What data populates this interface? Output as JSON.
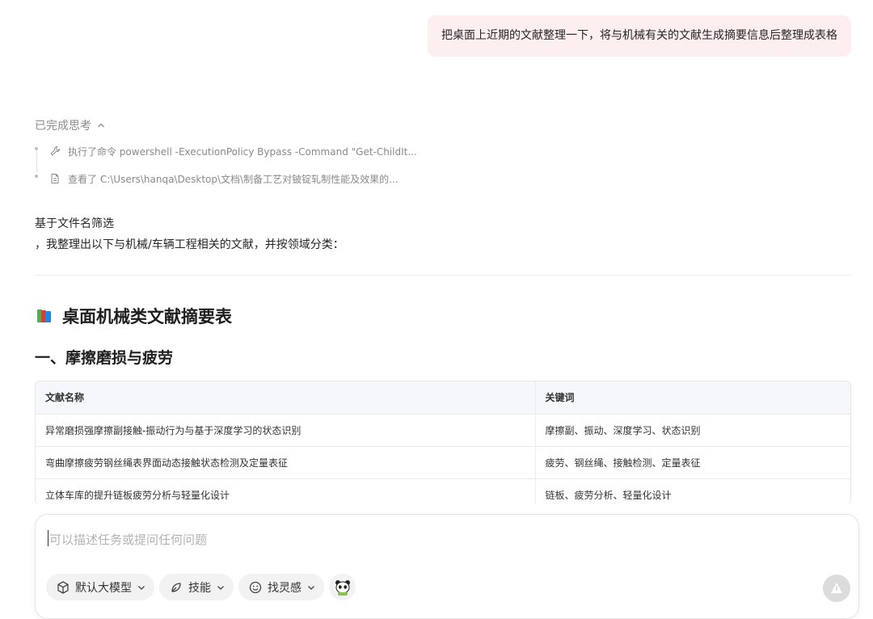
{
  "user_message": "把桌面上近期的文献整理一下，将与机械有关的文献生成摘要信息后整理成表格",
  "thinking": {
    "label": "已完成思考",
    "steps": [
      {
        "icon": "wrench-icon",
        "text": "执行了命令 powershell -ExecutionPolicy Bypass -Command \"Get-ChildIt..."
      },
      {
        "icon": "document-icon",
        "text": "查看了 C:\\Users\\hanqa\\Desktop\\文档\\制备工艺对铍锭轧制性能及效果的..."
      }
    ]
  },
  "reply": {
    "line1": "基于文件名筛选",
    "line2": "，我整理出以下与机械/车辆工程相关的文献，并按领域分类：",
    "heading": "桌面机械类文献摘要表",
    "section_title": "一、摩擦磨损与疲劳",
    "table": {
      "headers": [
        "文献名称",
        "关键词"
      ],
      "rows": [
        [
          "异常磨损强摩擦副接触-振动行为与基于深度学习的状态识别",
          "摩擦副、振动、深度学习、状态识别"
        ],
        [
          "弯曲摩擦疲劳钢丝绳表界面动态接触状态检测及定量表征",
          "疲劳、钢丝绳、接触检测、定量表征"
        ],
        [
          "立体车库的提升链板疲劳分析与轻量化设计",
          "链板、疲劳分析、轻量化设计"
        ]
      ]
    }
  },
  "composer": {
    "placeholder": "可以描述任务或提问任何问题",
    "chips": {
      "model": "默认大模型",
      "skills": "技能",
      "inspiration": "找灵感"
    }
  },
  "colors": {
    "user_bubble": "#fdeef0",
    "table_header": "#f5f7fa",
    "send_disabled": "#dcdcdc"
  }
}
